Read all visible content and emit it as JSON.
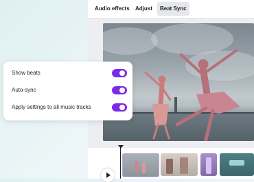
{
  "tabs": [
    {
      "label": "Audio effects",
      "active": false
    },
    {
      "label": "Adjust",
      "active": false
    },
    {
      "label": "Beat Sync",
      "active": true
    }
  ],
  "settings": [
    {
      "label": "Show beats",
      "on": true
    },
    {
      "label": "Auto-sync",
      "on": true
    },
    {
      "label": "Apply settings to all music tracks",
      "on": true
    }
  ],
  "colors": {
    "accent": "#7d2ae8",
    "panel": "#ffffff",
    "editor_bg": "#eceef2"
  },
  "icons": {
    "play": "play-icon",
    "playhead": "playhead-marker-icon"
  }
}
